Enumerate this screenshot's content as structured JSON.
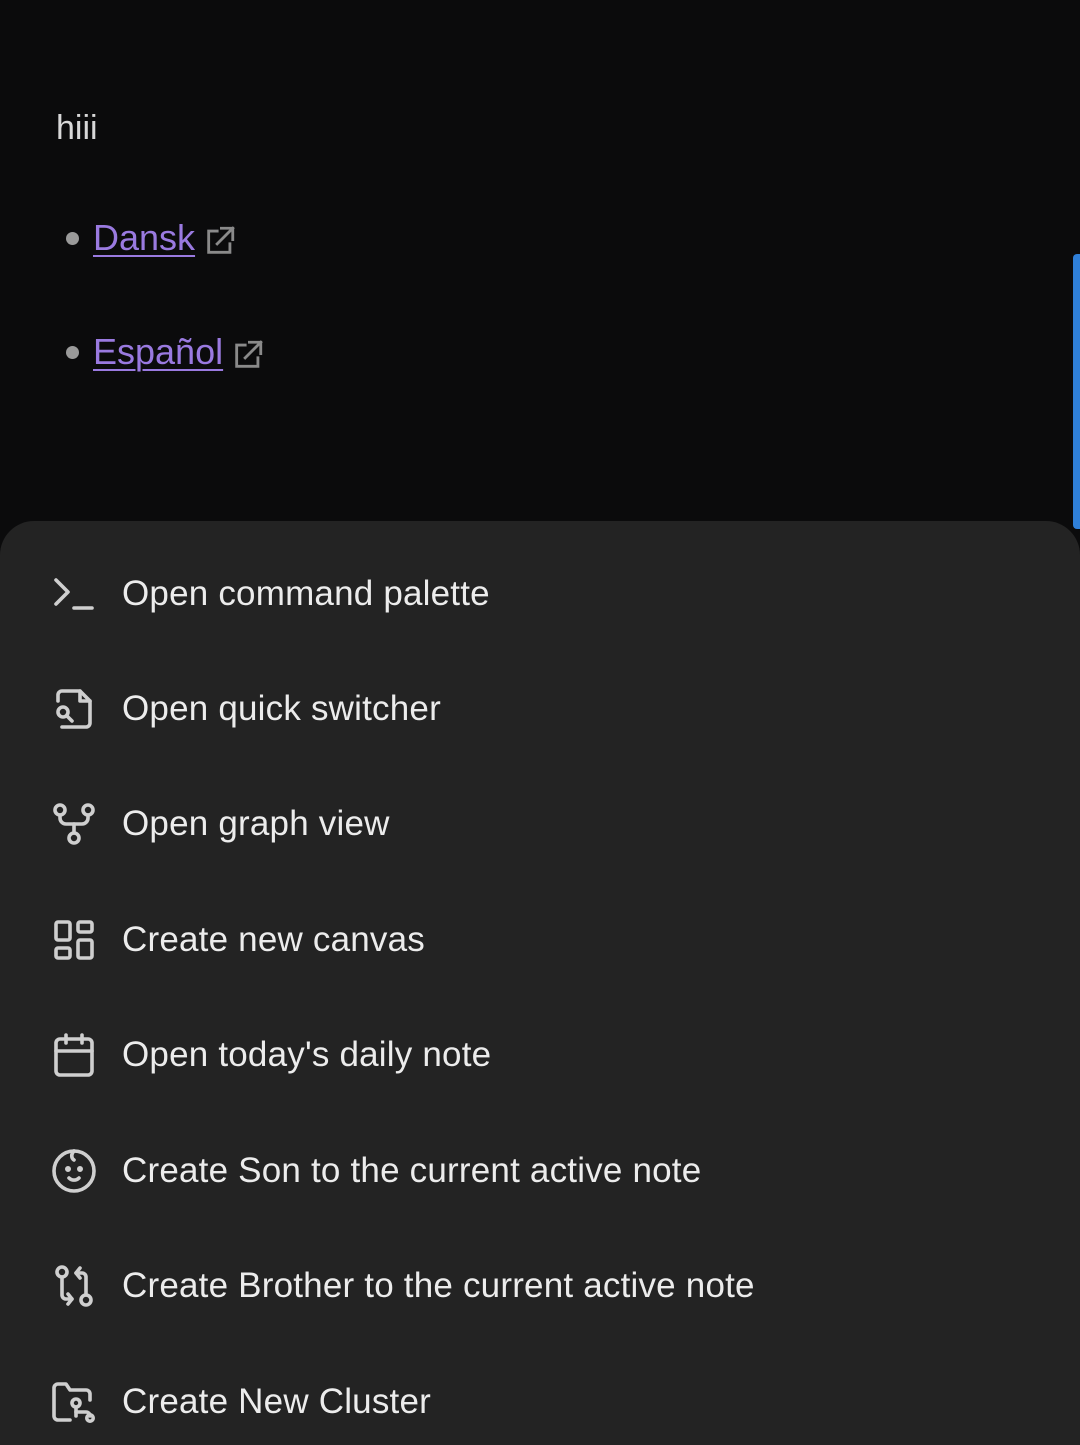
{
  "note": {
    "text": "hiii",
    "links": [
      {
        "label": "Dansk",
        "icon": "external-link-icon"
      },
      {
        "label": "Español",
        "icon": "external-link-icon"
      }
    ]
  },
  "menu": {
    "items": [
      {
        "label": "Open command palette",
        "icon": "terminal-icon"
      },
      {
        "label": "Open quick switcher",
        "icon": "file-search-icon"
      },
      {
        "label": "Open graph view",
        "icon": "graph-icon"
      },
      {
        "label": "Create new canvas",
        "icon": "layout-dashboard-icon"
      },
      {
        "label": "Open today's daily note",
        "icon": "calendar-icon"
      },
      {
        "label": "Create Son to the current active note",
        "icon": "baby-face-icon"
      },
      {
        "label": "Create Brother to the current active note",
        "icon": "git-compare-icon"
      },
      {
        "label": "Create New Cluster",
        "icon": "folder-tree-icon"
      }
    ]
  },
  "colors": {
    "background": "#0b0b0c",
    "sheet": "#232323",
    "link": "#9a7ae0",
    "accent_scroll": "#2f7fd8",
    "text": "#ececec"
  }
}
